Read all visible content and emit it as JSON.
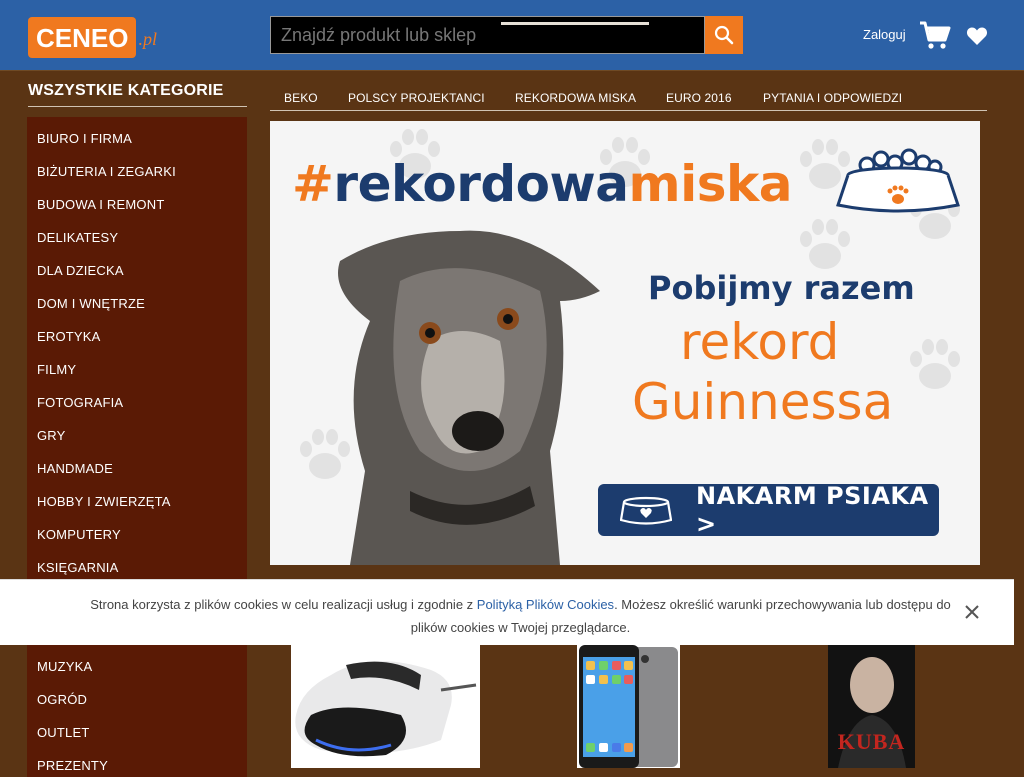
{
  "header": {
    "logo_text": "CENEO",
    "logo_suffix": ".pl",
    "search_placeholder": "Znajdź produkt lub sklep",
    "login_label": "Zaloguj"
  },
  "sidebar": {
    "title": "WSZYSTKIE KATEGORIE",
    "items": [
      "BIURO I FIRMA",
      "BIŻUTERIA I ZEGARKI",
      "BUDOWA I REMONT",
      "DELIKATESY",
      "DLA DZIECKA",
      "DOM I WNĘTRZE",
      "EROTYKA",
      "FILMY",
      "FOTOGRAFIA",
      "GRY",
      "HANDMADE",
      "HOBBY I ZWIERZĘTA",
      "KOMPUTERY",
      "KSIĘGARNIA",
      "MUZYKA",
      "OGRÓD",
      "OUTLET",
      "PREZENTY"
    ]
  },
  "tabs": [
    "BEKO",
    "POLSCY PROJEKTANCI",
    "REKORDOWA MISKA",
    "EURO 2016",
    "PYTANIA I ODPOWIEDZI"
  ],
  "active_tab": "REKORDOWA MISKA",
  "banner": {
    "hashtag_prefix": "#",
    "hashtag_part1": "rekordowa",
    "hashtag_part2": "miska",
    "line1": "Pobijmy razem",
    "line2": "rekord",
    "line3": "Guinnessa",
    "cta_label": "NAKARM PSIAKA >"
  },
  "cookie": {
    "text_before": "Strona korzysta z plików cookies w celu realizacji usług i zgodnie z ",
    "link_text": "Polityką Plików Cookies",
    "text_after": ". Możesz określić warunki przechowywania lub dostępu do plików cookies w Twojej przeglądarce."
  },
  "products": {
    "book_title": "KUBA"
  },
  "colors": {
    "header_bg": "#2c61a6",
    "accent_orange": "#f0791f",
    "page_bg": "#5a3414",
    "sidebar_bg": "#5a1a05",
    "banner_navy": "#1c3c6e"
  }
}
